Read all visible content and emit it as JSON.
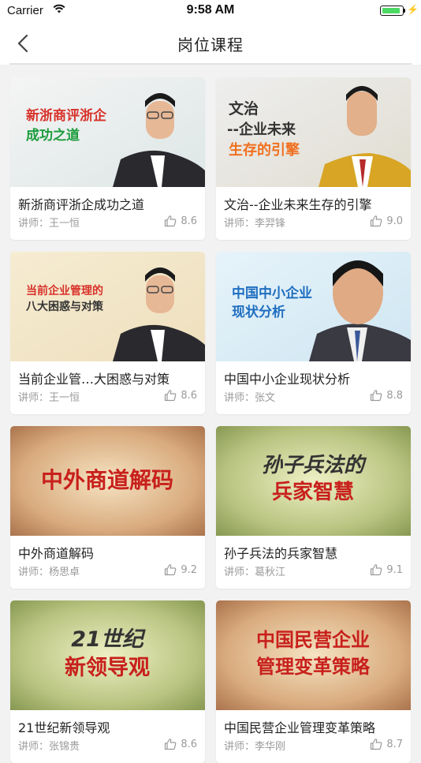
{
  "status_bar": {
    "carrier": "Carrier",
    "time": "9:58 AM",
    "battery_color": "#4cd964"
  },
  "nav": {
    "title": "岗位课程",
    "back_icon": "chevron-left-icon"
  },
  "courses": [
    {
      "title": "新浙商评浙企成功之道",
      "lecturer": "讲师：王一恒",
      "rating": "8.6",
      "thumb_line1": "新浙商评浙企",
      "thumb_line2": "成功之道"
    },
    {
      "title": "文治--企业未来生存的引擎",
      "lecturer": "讲师：李羿锋",
      "rating": "9.0",
      "thumb_line1": "文治",
      "thumb_line2": "--企业未来",
      "thumb_line3": "生存的引擎"
    },
    {
      "title": "当前企业管…大困惑与对策",
      "lecturer": "讲师：王一恒",
      "rating": "8.6",
      "thumb_line1": "当前企业管理的",
      "thumb_line2": "八大困惑与对策"
    },
    {
      "title": "中国中小企业现状分析",
      "lecturer": "讲师：张文",
      "rating": "8.8",
      "thumb_line1": "中国中小企业",
      "thumb_line2": "现状分析"
    },
    {
      "title": "中外商道解码",
      "lecturer": "讲师：杨思卓",
      "rating": "9.2",
      "thumb_line1": "中外商道解码"
    },
    {
      "title": "孙子兵法的兵家智慧",
      "lecturer": "讲师：葛秋江",
      "rating": "9.1",
      "thumb_line1": "孙子兵法的",
      "thumb_line2": "兵家智慧"
    },
    {
      "title": "21世纪新领导观",
      "lecturer": "讲师：张锦贵",
      "rating": "8.6",
      "thumb_line1": "21世纪",
      "thumb_line2": "新领导观"
    },
    {
      "title": "中国民营企业管理变革策略",
      "lecturer": "讲师：李华刚",
      "rating": "8.7",
      "thumb_line1": "中国民营企业",
      "thumb_line2": "管理变革策略"
    }
  ],
  "colors": {
    "background": "#f2f2f2",
    "card": "#ffffff",
    "title_text": "#222222",
    "meta_text": "#9a9a9a",
    "red_text": "#d8322a",
    "orange_text": "#f07020",
    "green_text": "#1c9c3c",
    "blue_text": "#1f6fc0"
  },
  "icons": {
    "like": "thumbs-up-icon",
    "wifi": "wifi-icon",
    "battery": "battery-icon"
  }
}
